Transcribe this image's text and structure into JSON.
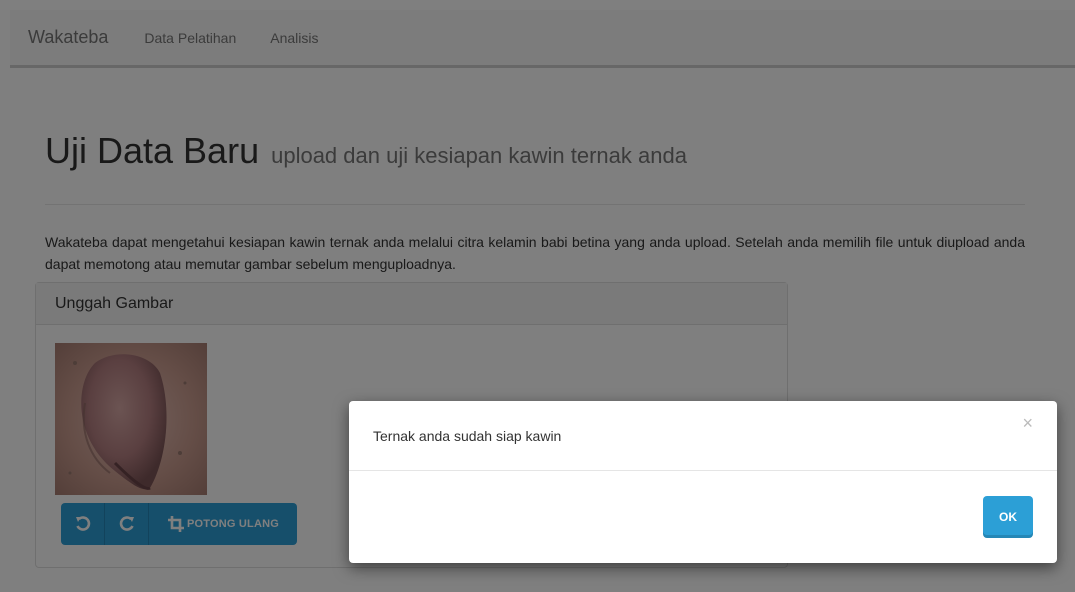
{
  "navbar": {
    "brand": "Wakateba",
    "links": [
      "Data Pelatihan",
      "Analisis"
    ]
  },
  "header": {
    "title": "Uji Data Baru",
    "subtitle": "upload dan uji kesiapan kawin ternak anda"
  },
  "description": "Wakateba dapat mengetahui kesiapan kawin ternak anda melalui citra kelamin babi betina yang anda upload. Setelah anda memilih file untuk diupload anda dapat memotong atau memutar gambar sebelum menguploadnya.",
  "panel": {
    "heading": "Unggah Gambar",
    "buttons": {
      "rotate_left_icon": "rotate-left-icon",
      "rotate_right_icon": "rotate-right-icon",
      "crop_label": "POTONG ULANG",
      "crop_icon": "crop-icon"
    }
  },
  "modal": {
    "message": "Ternak anda sudah siap kawin",
    "close_symbol": "×",
    "ok_label": "OK"
  },
  "colors": {
    "primary": "#2c9fd6",
    "backdrop": "rgba(0,0,0,0.5)"
  }
}
